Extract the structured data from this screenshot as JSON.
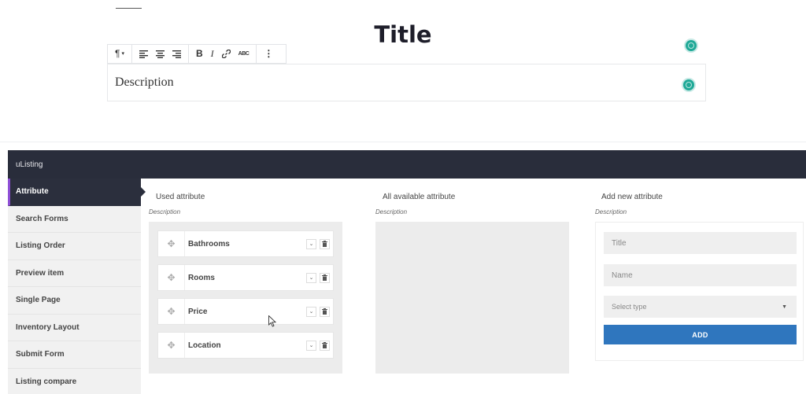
{
  "editor": {
    "title": "Title",
    "description": "Description",
    "toolbar": {
      "paragraph_icon": "¶",
      "paragraph_caret": "▾",
      "bold": "B",
      "italic": "I",
      "strike": "ABC",
      "more": "⋮"
    }
  },
  "panel": {
    "title": "uListing",
    "sidebar": {
      "items": [
        {
          "label": "Attribute"
        },
        {
          "label": "Search Forms"
        },
        {
          "label": "Listing Order"
        },
        {
          "label": "Preview item"
        },
        {
          "label": "Single Page"
        },
        {
          "label": "Inventory Layout"
        },
        {
          "label": "Submit Form"
        },
        {
          "label": "Listing compare"
        }
      ]
    },
    "used": {
      "title": "Used attribute",
      "description": "Description",
      "attributes": [
        {
          "name": "Bathrooms"
        },
        {
          "name": "Rooms"
        },
        {
          "name": "Price"
        },
        {
          "name": "Location"
        }
      ]
    },
    "available": {
      "title": "All available attribute",
      "description": "Description"
    },
    "add_new": {
      "title": "Add new attribute",
      "description": "Description",
      "title_placeholder": "Title",
      "name_placeholder": "Name",
      "select_placeholder": "Select type",
      "add_label": "ADD"
    }
  },
  "colors": {
    "header_bg": "#292d3b",
    "active_accent": "#8e4fd6",
    "add_button": "#2f76be",
    "dot": "#1fa997"
  }
}
